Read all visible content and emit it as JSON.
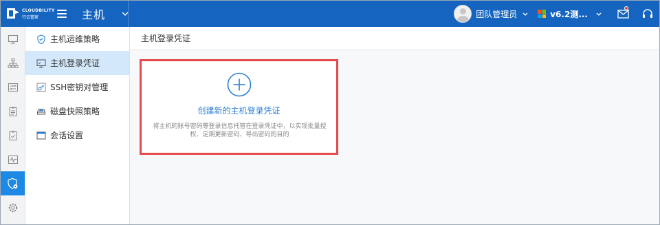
{
  "header": {
    "logo_en": "CLOUDBILITY",
    "logo_cn": "行云管家",
    "app_title": "主机",
    "user_name": "团队管理员",
    "version_label": "v6.2测..."
  },
  "rail": {
    "items": [
      {
        "name": "rail-hosts",
        "icon": "monitor-icon"
      },
      {
        "name": "rail-topology",
        "icon": "network-icon"
      },
      {
        "name": "rail-transfer",
        "icon": "transfer-icon"
      },
      {
        "name": "rail-tasks",
        "icon": "clipboard-icon"
      },
      {
        "name": "rail-audit",
        "icon": "clipboard-check-icon"
      },
      {
        "name": "rail-monitor",
        "icon": "pulse-icon"
      },
      {
        "name": "rail-security",
        "icon": "shield-gear-icon",
        "active": true
      },
      {
        "name": "rail-settings",
        "icon": "gear-icon"
      }
    ]
  },
  "submenu": {
    "items": [
      {
        "label": "主机运维策略",
        "icon": "shield-check-icon"
      },
      {
        "label": "主机登录凭证",
        "icon": "credential-monitor-icon",
        "active": true
      },
      {
        "label": "SSH密钥对管理",
        "icon": "key-icon"
      },
      {
        "label": "磁盘快照策略",
        "icon": "disk-snapshot-icon"
      },
      {
        "label": "会话设置",
        "icon": "window-icon"
      }
    ]
  },
  "main": {
    "page_title": "主机登录凭证",
    "create_card": {
      "title": "创建新的主机登录凭证",
      "description": "将主机的账号密码等登录信息托管在登录凭证中，以实现批量授权、定期更新密码、导出密码的目的"
    }
  },
  "colors": {
    "topbar": "#1565c0",
    "accent": "#1e88e5",
    "active_submenu": "#d4e8fb",
    "highlight_border": "#e5484d"
  }
}
